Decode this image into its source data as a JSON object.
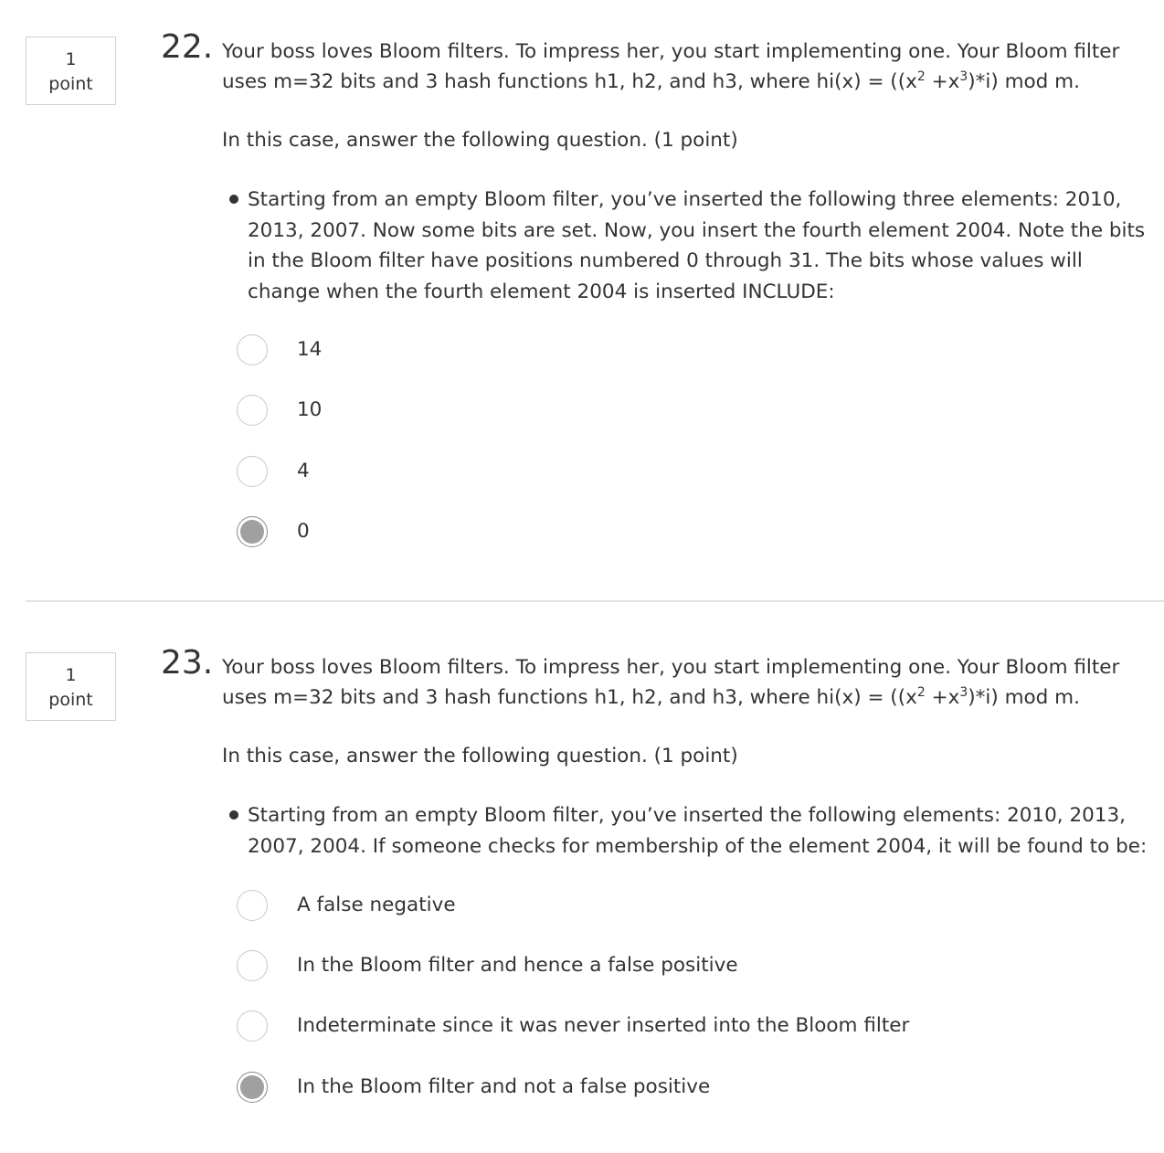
{
  "questions": [
    {
      "points": {
        "value": "1",
        "unit": "point"
      },
      "number": "22.",
      "prompt": {
        "line1": "Your boss loves Bloom filters. To impress her, you start implementing one. Your Bloom filter",
        "line2_a": "uses m=32 bits and 3 hash functions h1, h2, and h3, where hi(x) = ((x",
        "sup1": "2",
        "line2_b": " +x",
        "sup2": "3",
        "line2_c": ")*i) mod m."
      },
      "instruction": "In this case, answer the following question. (1 point)",
      "bullet": [
        "Starting from an empty Bloom filter, you’ve inserted the following three elements: 2010,",
        "2013, 2007. Now some bits are set. Now, you insert the fourth element 2004. Note the bits",
        "in the Bloom filter have positions numbered 0 through 31. The bits whose values will",
        "change when the fourth element 2004 is inserted INCLUDE:"
      ],
      "options": [
        {
          "label": "14",
          "selected": false
        },
        {
          "label": "10",
          "selected": false
        },
        {
          "label": "4",
          "selected": false
        },
        {
          "label": "0",
          "selected": true
        }
      ]
    },
    {
      "points": {
        "value": "1",
        "unit": "point"
      },
      "number": "23.",
      "prompt": {
        "line1": "Your boss loves Bloom filters. To impress her, you start implementing one. Your Bloom filter",
        "line2_a": "uses m=32 bits and 3 hash functions h1, h2, and h3, where hi(x) = ((x",
        "sup1": "2",
        "line2_b": " +x",
        "sup2": "3",
        "line2_c": ")*i) mod m."
      },
      "instruction": "In this case, answer the following question. (1 point)",
      "bullet": [
        "Starting from an empty Bloom filter, you’ve inserted the following elements: 2010, 2013,",
        "2007, 2004. If someone checks for membership of the element 2004, it will be found to be:"
      ],
      "options": [
        {
          "label": "A false negative",
          "selected": false
        },
        {
          "label": "In the Bloom filter and hence a false positive",
          "selected": false
        },
        {
          "label": "Indeterminate since it was never inserted into the Bloom filter",
          "selected": false
        },
        {
          "label": "In the Bloom filter and not a false positive",
          "selected": true
        }
      ]
    }
  ],
  "colors": {
    "text": "#333333",
    "border": "#cfcfcf",
    "radio_fill_selected": "#a0a0a0",
    "divider": "#e3e3e3"
  }
}
